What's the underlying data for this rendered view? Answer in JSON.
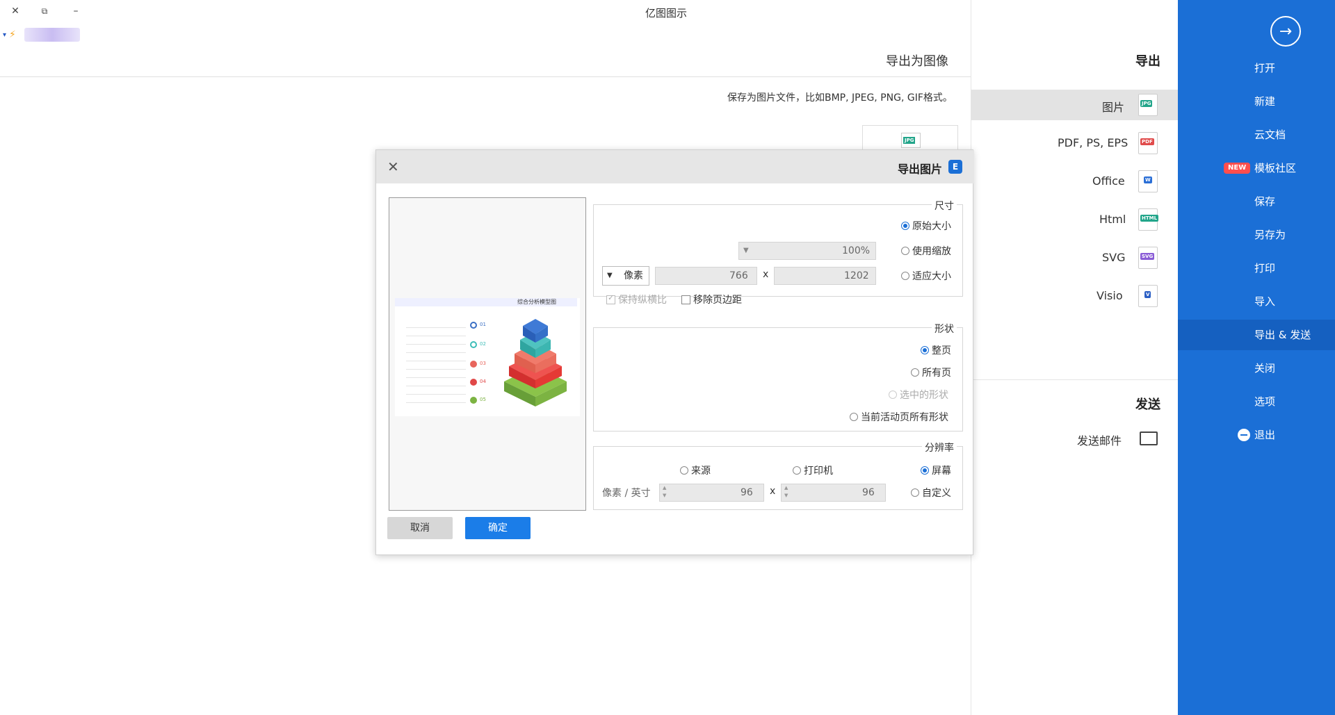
{
  "window": {
    "title": "亿图图示",
    "close": "✕",
    "restore": "⧉",
    "minimize": "–",
    "user_caret": "▾",
    "vip_icon": "⚡"
  },
  "sidebar": {
    "back_icon": "→",
    "items": [
      {
        "label": "打开"
      },
      {
        "label": "新建"
      },
      {
        "label": "云文档"
      },
      {
        "label": "模板社区",
        "badge": "NEW"
      },
      {
        "label": "保存"
      },
      {
        "label": "另存为"
      },
      {
        "label": "打印"
      },
      {
        "label": "导入"
      },
      {
        "label": "导出 & 发送",
        "active": true
      },
      {
        "label": "关闭"
      },
      {
        "label": "选项"
      },
      {
        "label": "退出"
      }
    ]
  },
  "export_panel": {
    "export_heading": "导出",
    "items": [
      {
        "label": "图片",
        "icon_text": "JPG",
        "color": "#22a58a"
      },
      {
        "label": "PDF, PS, EPS",
        "icon_text": "PDF",
        "color": "#e04b4b"
      },
      {
        "label": "Office",
        "icon_text": "W",
        "color": "#2b6fd6"
      },
      {
        "label": "Html",
        "icon_text": "HTML",
        "color": "#22a58a"
      },
      {
        "label": "SVG",
        "icon_text": "SVG",
        "color": "#8a5cd6"
      },
      {
        "label": "Visio",
        "icon_text": "V",
        "color": "#2b5fc4"
      }
    ],
    "send_heading": "发送",
    "send_items": [
      {
        "label": "发送邮件"
      }
    ]
  },
  "main": {
    "title": "导出为图像",
    "description": "保存为图片文件，比如BMP, JPEG, PNG, GIF格式。",
    "thumb_icon_text": "JPG"
  },
  "dialog": {
    "title": "导出图片",
    "logo": "E",
    "close": "✕",
    "size_group": {
      "legend": "尺寸",
      "original": "原始大小",
      "zoom": "使用缩放",
      "zoom_value": "100%",
      "fit": "适应大小",
      "width": "1202",
      "height": "766",
      "x_sep": "x",
      "unit": "像素",
      "remove_margin": "移除页边距",
      "keep_ratio": "保持纵横比"
    },
    "shape_group": {
      "legend": "形状",
      "whole_page": "整页",
      "all_pages": "所有页",
      "selected": "选中的形状",
      "current_all": "当前活动页所有形状"
    },
    "resolution_group": {
      "legend": "分辨率",
      "screen": "屏幕",
      "printer": "打印机",
      "source": "来源",
      "custom": "自定义",
      "dpi_x": "96",
      "dpi_y": "96",
      "x_sep": "x",
      "unit": "像素 / 英寸"
    },
    "ok": "确定",
    "cancel": "取消",
    "preview": {
      "title": "综合分析模型图",
      "rows": [
        "01",
        "02",
        "03",
        "04",
        "05"
      ],
      "row_colors": [
        "#3a6fc4",
        "#3dbdb8",
        "#e8655c",
        "#e04848",
        "#7cb342"
      ]
    }
  }
}
